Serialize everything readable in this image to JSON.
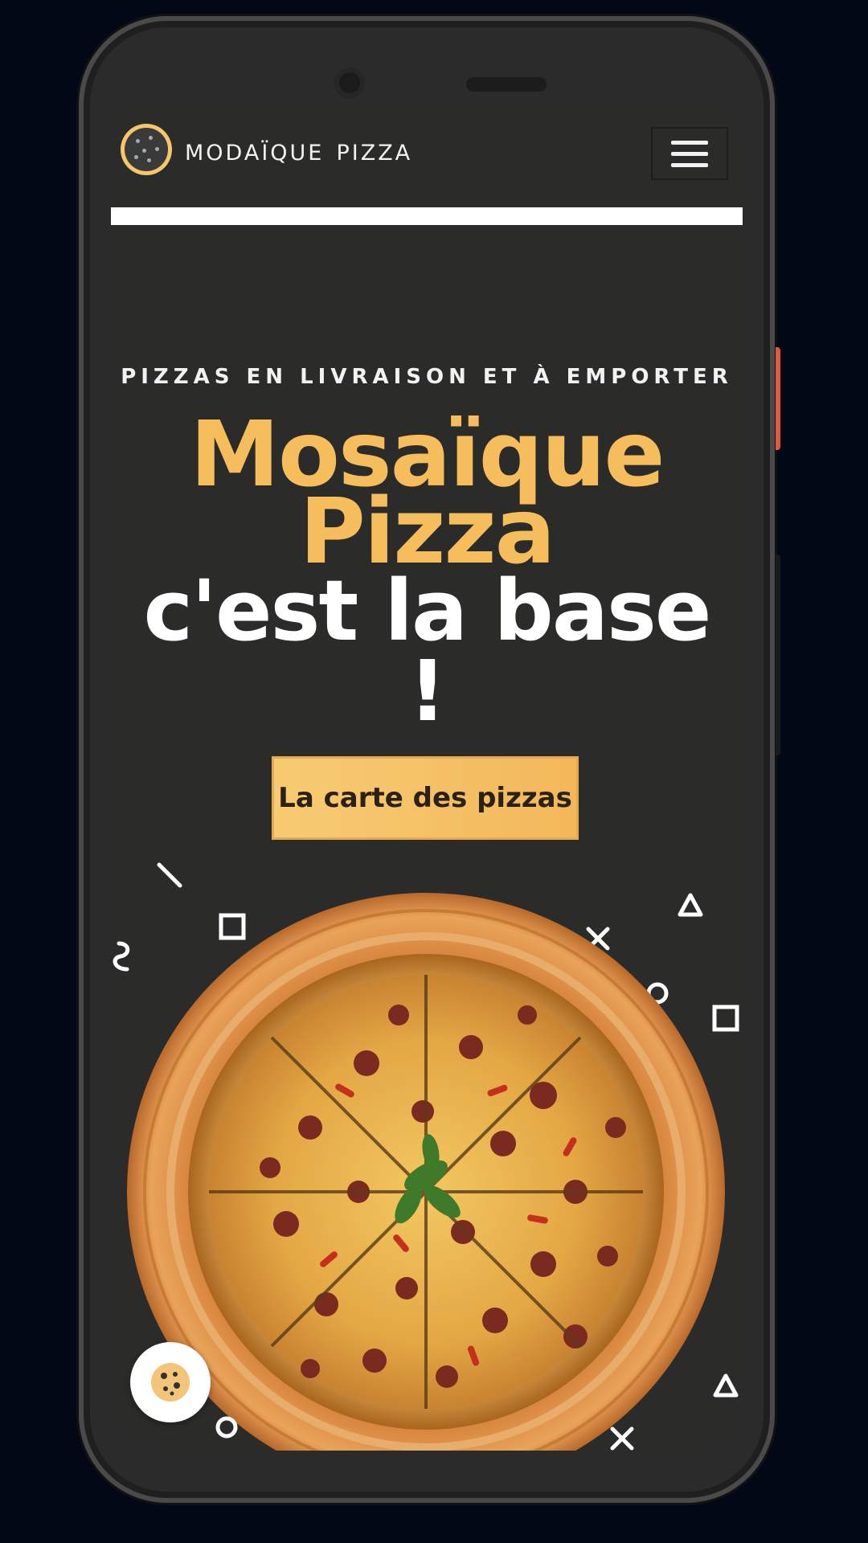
{
  "header": {
    "brand": "moDaïque pizza",
    "menu_label": "Menu"
  },
  "hero": {
    "kicker": "PIZZAS EN LIVRAISON ET À EMPORTER",
    "title_line1": "Mosaïque",
    "title_line2": "Pizza",
    "subtitle_line1": "c'est la base",
    "subtitle_line2": "!",
    "cta_label": "La carte des pizzas"
  },
  "colors": {
    "background": "#2b2c2a",
    "accent": "#f5bd5c",
    "text": "#ffffff"
  },
  "icons": {
    "menu": "hamburger-icon",
    "cookie": "cookie-icon",
    "logo": "pizza-logo-icon"
  }
}
